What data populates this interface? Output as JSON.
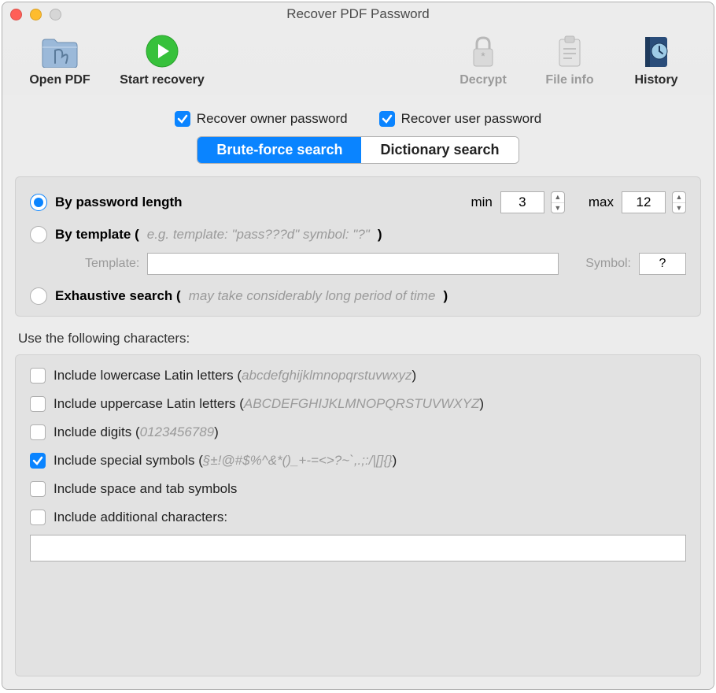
{
  "window": {
    "title": "Recover PDF Password"
  },
  "toolbar": {
    "open_pdf": "Open PDF",
    "start_recovery": "Start recovery",
    "decrypt": "Decrypt",
    "file_info": "File info",
    "history": "History"
  },
  "top_checks": {
    "owner": "Recover owner password",
    "user": "Recover user password",
    "owner_checked": true,
    "user_checked": true
  },
  "segmented": {
    "brute": "Brute-force search",
    "dict": "Dictionary search",
    "active": "brute"
  },
  "method": {
    "by_length": "By password length",
    "by_template": "By template (",
    "by_template_hint": "e.g. template: \"pass???d\" symbol: \"?\"",
    "by_template_close": ")",
    "exhaustive": "Exhaustive search (",
    "exhaustive_hint": "may take considerably long period of time",
    "exhaustive_close": ")",
    "min_label": "min",
    "min_value": "3",
    "max_label": "max",
    "max_value": "12",
    "template_label": "Template:",
    "template_value": "",
    "symbol_label": "Symbol:",
    "symbol_value": "?"
  },
  "charset": {
    "header": "Use the following characters:",
    "lowercase_label": "Include lowercase Latin letters (",
    "lowercase_hint": "abcdefghijklmnopqrstuvwxyz",
    "uppercase_label": "Include uppercase Latin letters (",
    "uppercase_hint": "ABCDEFGHIJKLMNOPQRSTUVWXYZ",
    "digits_label": "Include digits (",
    "digits_hint": "0123456789",
    "special_label": "Include special symbols (",
    "special_hint": "§±!@#$%^&*()_+-=<>?~`,.;:/|[]{}",
    "close": ")",
    "space_label": "Include space and tab symbols",
    "additional_label": "Include additional characters:",
    "additional_value": "",
    "checked": {
      "lowercase": false,
      "uppercase": false,
      "digits": false,
      "special": true,
      "space": false,
      "additional": false
    }
  }
}
